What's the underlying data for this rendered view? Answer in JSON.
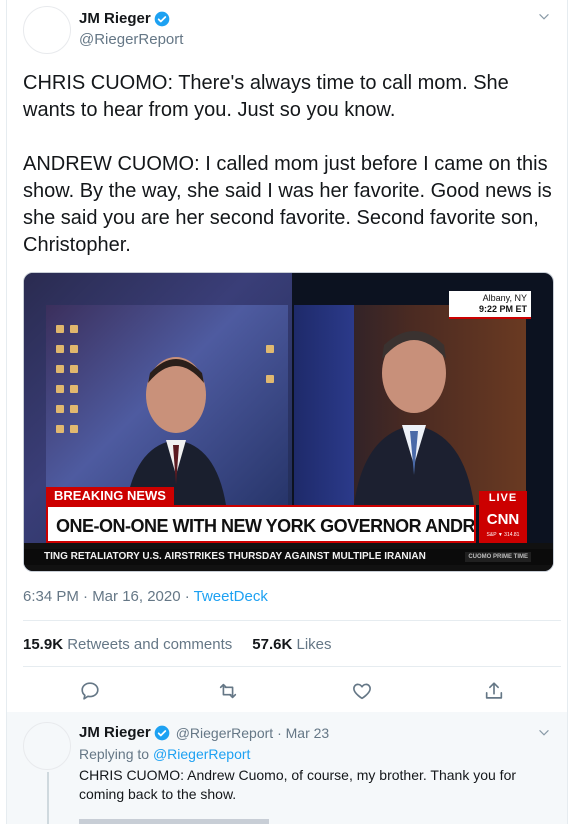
{
  "tweet": {
    "author_name": "JM Rieger",
    "author_handle": "@RiegerReport",
    "paragraphs": [
      "CHRIS CUOMO: There's always time to call mom. She wants to hear from you. Just so you know.",
      "ANDREW CUOMO: I called mom just before I came on this show. By the way, she said I was her favorite. Good news is she said you are her second favorite. Second favorite son, Christopher."
    ],
    "media": {
      "location": "Albany, NY",
      "time": "9:22 PM ET",
      "breaking": "BREAKING NEWS",
      "live": "LIVE",
      "headline": "ONE-ON-ONE WITH NEW YORK GOVERNOR ANDREW CUOMO",
      "network": "CNN",
      "stock": "S&P ▼ 314.81",
      "ticker": "TING RETALIATORY U.S. AIRSTRIKES THURSDAY AGAINST MULTIPLE IRANIAN",
      "show_badge": "CUOMO PRIME TIME"
    },
    "timestamp": "6:34 PM · Mar 16, 2020 · ",
    "source": "TweetDeck",
    "retweets_count": "15.9K",
    "retweets_label": "Retweets and comments",
    "likes_count": "57.6K",
    "likes_label": "Likes"
  },
  "reply": {
    "author_name": "JM Rieger",
    "author_handle": "@RiegerReport · Mar 23",
    "replying_prefix": "Replying to ",
    "replying_to": "@RiegerReport",
    "text": "CHRIS CUOMO: Andrew Cuomo, of course, my brother. Thank you for coming back to the show."
  },
  "icons": {
    "verified": "verified-badge-icon",
    "chevron": "chevron-down-icon",
    "reply": "reply-icon",
    "retweet": "retweet-icon",
    "like": "heart-icon",
    "share": "share-icon"
  },
  "colors": {
    "accent": "#1da1f2",
    "secondary_text": "#657786",
    "cnn_red": "#cc0000"
  }
}
